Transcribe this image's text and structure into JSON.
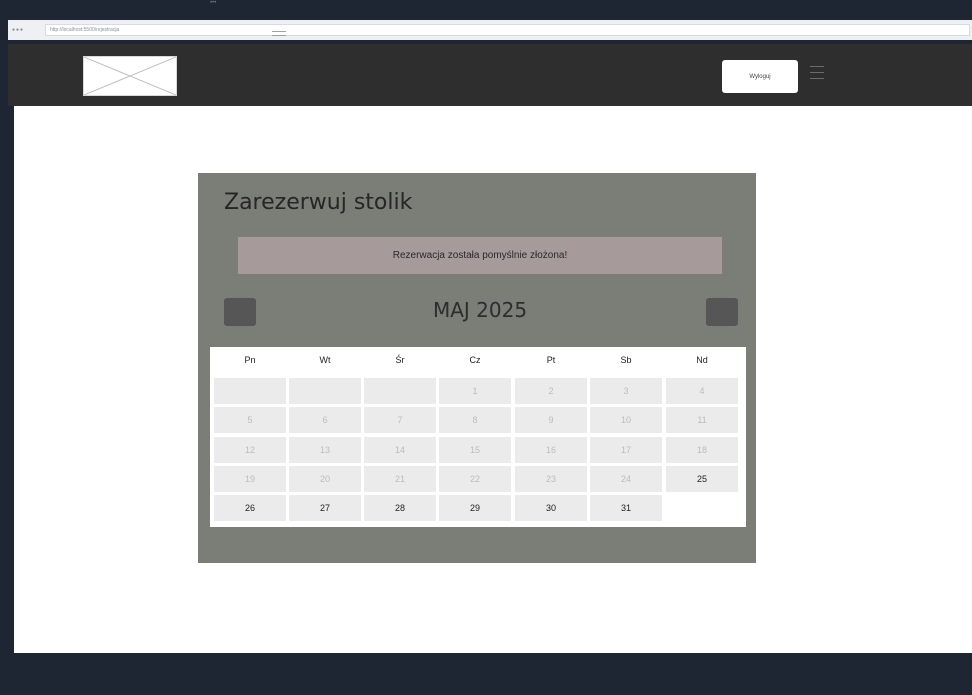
{
  "browser": {
    "url": "http://localhost:5500/rejestracja"
  },
  "header": {
    "logout_label": "Wyloguj"
  },
  "booking": {
    "title": "Zarezerwuj stolik",
    "success_message": "Rezerwacja została pomyślnie złożona!",
    "month_label": "MAJ 2025",
    "weekdays": [
      "Pn",
      "Wt",
      "Śr",
      "Cz",
      "Pt",
      "Sb",
      "Nd"
    ],
    "days": [
      {
        "day": "",
        "state": "blank"
      },
      {
        "day": "",
        "state": "blank"
      },
      {
        "day": "",
        "state": "blank"
      },
      {
        "day": "1",
        "state": "disabled"
      },
      {
        "day": "2",
        "state": "disabled"
      },
      {
        "day": "3",
        "state": "disabled"
      },
      {
        "day": "4",
        "state": "disabled"
      },
      {
        "day": "5",
        "state": "disabled"
      },
      {
        "day": "6",
        "state": "disabled"
      },
      {
        "day": "7",
        "state": "disabled"
      },
      {
        "day": "8",
        "state": "disabled"
      },
      {
        "day": "9",
        "state": "disabled"
      },
      {
        "day": "10",
        "state": "disabled"
      },
      {
        "day": "11",
        "state": "disabled"
      },
      {
        "day": "12",
        "state": "disabled"
      },
      {
        "day": "13",
        "state": "disabled"
      },
      {
        "day": "14",
        "state": "disabled"
      },
      {
        "day": "15",
        "state": "disabled"
      },
      {
        "day": "16",
        "state": "disabled"
      },
      {
        "day": "17",
        "state": "disabled"
      },
      {
        "day": "18",
        "state": "disabled"
      },
      {
        "day": "19",
        "state": "disabled"
      },
      {
        "day": "20",
        "state": "disabled"
      },
      {
        "day": "21",
        "state": "disabled"
      },
      {
        "day": "22",
        "state": "disabled"
      },
      {
        "day": "23",
        "state": "disabled"
      },
      {
        "day": "24",
        "state": "disabled"
      },
      {
        "day": "25",
        "state": "available"
      },
      {
        "day": "26",
        "state": "available"
      },
      {
        "day": "27",
        "state": "available"
      },
      {
        "day": "28",
        "state": "available"
      },
      {
        "day": "29",
        "state": "available"
      },
      {
        "day": "30",
        "state": "available"
      },
      {
        "day": "31",
        "state": "available"
      }
    ]
  },
  "colors": {
    "header_bg": "#2e2e2e",
    "panel_bg": "#7b7d77",
    "banner_bg": "#a69a9a",
    "nav_button_bg": "#565656",
    "cell_bg": "#ebebeb"
  },
  "icons": {
    "logo": "image-placeholder-icon",
    "menu": "hamburger-icon",
    "prev": "chevron-left-icon",
    "next": "chevron-right-icon"
  }
}
